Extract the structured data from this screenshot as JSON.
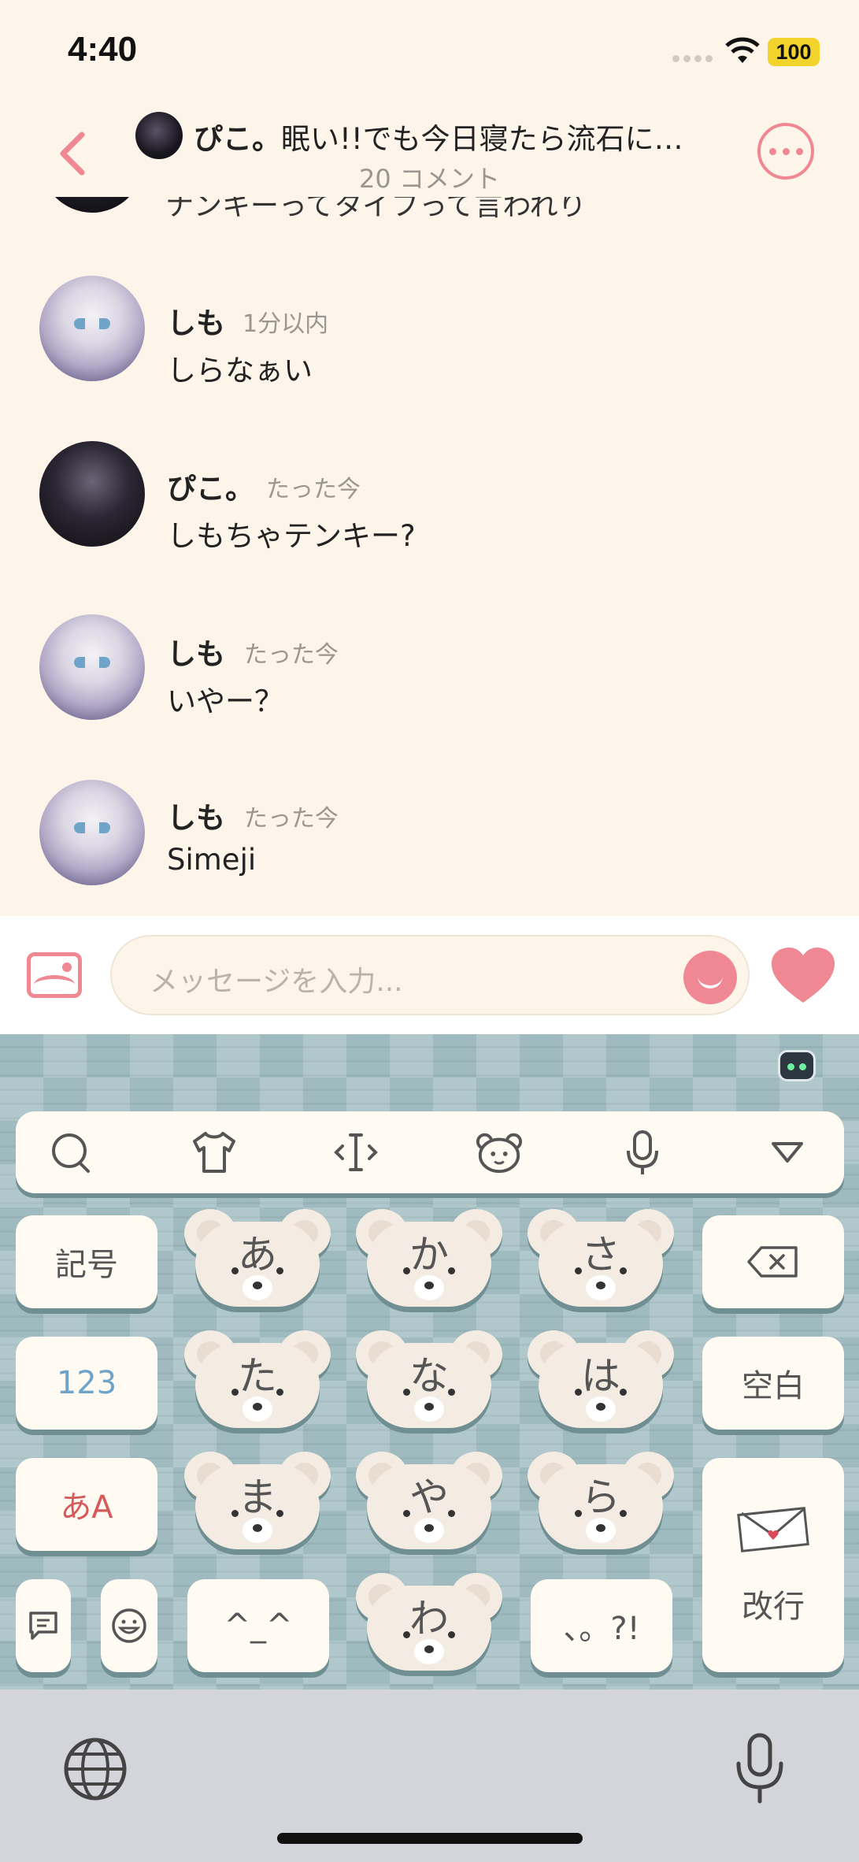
{
  "status_bar": {
    "time": "4:40",
    "battery": "100"
  },
  "header": {
    "author": "ぴこ。",
    "title_rest": "眠い!!でも今日寝たら流石に…",
    "subtitle": "20 コメント"
  },
  "partial_comment": {
    "text": "ナンキーってタイフって言われり"
  },
  "comments": [
    {
      "name": "しも",
      "time": "1分以内",
      "text": "しらなぁい",
      "avatar": "shimo"
    },
    {
      "name": "ぴこ。",
      "time": "たった今",
      "text": "しもちゃテンキー?",
      "avatar": "piko"
    },
    {
      "name": "しも",
      "time": "たった今",
      "text": "いやー？",
      "avatar": "shimo"
    },
    {
      "name": "しも",
      "time": "たった今",
      "text": "Simeji",
      "avatar": "shimo"
    }
  ],
  "input": {
    "placeholder": "メッセージを入力..."
  },
  "keyboard": {
    "left_keys": {
      "symbols": "記号",
      "numbers": "123",
      "kana_alpha": "あA",
      "kaomoji": "^_^",
      "punct": "、。?!",
      "space": "空白",
      "enter": "改行"
    },
    "kana_keys": [
      "あ",
      "か",
      "さ",
      "た",
      "な",
      "は",
      "ま",
      "や",
      "ら",
      "わ"
    ],
    "toolbar_icons": [
      "search-icon",
      "shirt-icon",
      "cursor-icon",
      "bear-icon",
      "mic-icon",
      "collapse-icon"
    ]
  },
  "colors": {
    "accent": "#ef8893",
    "background": "#fdf5e9",
    "keyboard": "#9fbbbf"
  }
}
